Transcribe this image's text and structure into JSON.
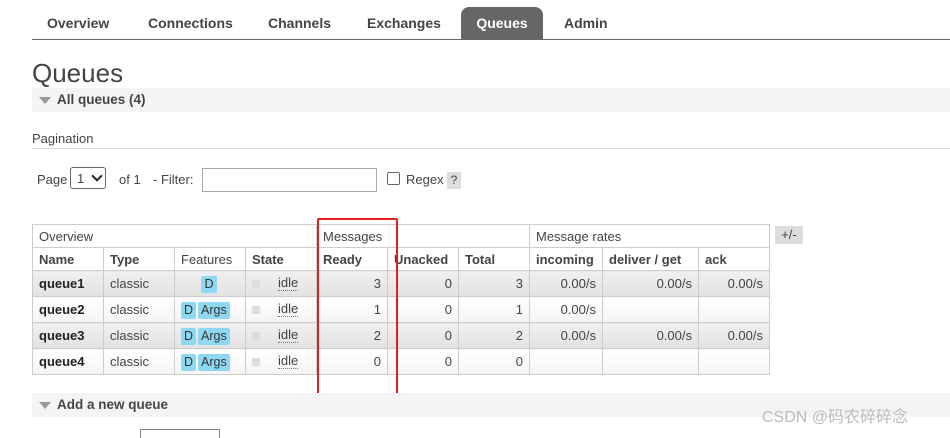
{
  "nav": {
    "items": [
      "Overview",
      "Connections",
      "Channels",
      "Exchanges",
      "Queues",
      "Admin"
    ],
    "active": "Queues"
  },
  "page_title": "Queues",
  "all_queues_label": "All queues (4)",
  "pagination": {
    "label": "Pagination",
    "page_label": "Page",
    "page_value": "1",
    "of_label": "of 1",
    "filter_label": "- Filter:",
    "filter_value": "",
    "regex_label": "Regex",
    "help_label": "?"
  },
  "table": {
    "groups": [
      "Overview",
      "Messages",
      "Message rates"
    ],
    "columns": [
      "Name",
      "Type",
      "Features",
      "State",
      "Ready",
      "Unacked",
      "Total",
      "incoming",
      "deliver / get",
      "ack"
    ],
    "plus_minus": "+/-",
    "rows": [
      {
        "name": "queue1",
        "type": "classic",
        "features": [
          "D"
        ],
        "state": "idle",
        "ready": "3",
        "unacked": "0",
        "total": "3",
        "incoming": "0.00/s",
        "deliver_get": "0.00/s",
        "ack": "0.00/s"
      },
      {
        "name": "queue2",
        "type": "classic",
        "features": [
          "D",
          "Args"
        ],
        "state": "idle",
        "ready": "1",
        "unacked": "0",
        "total": "1",
        "incoming": "0.00/s",
        "deliver_get": "",
        "ack": ""
      },
      {
        "name": "queue3",
        "type": "classic",
        "features": [
          "D",
          "Args"
        ],
        "state": "idle",
        "ready": "2",
        "unacked": "0",
        "total": "2",
        "incoming": "0.00/s",
        "deliver_get": "0.00/s",
        "ack": "0.00/s"
      },
      {
        "name": "queue4",
        "type": "classic",
        "features": [
          "D",
          "Args"
        ],
        "state": "idle",
        "ready": "0",
        "unacked": "0",
        "total": "0",
        "incoming": "",
        "deliver_get": "",
        "ack": ""
      }
    ]
  },
  "add_queue_label": "Add a new queue",
  "watermark": "CSDN @码农碎碎念",
  "colors": {
    "highlight": "#e02020",
    "feature_tag": "#8ed8f4",
    "active_tab": "#666666"
  }
}
